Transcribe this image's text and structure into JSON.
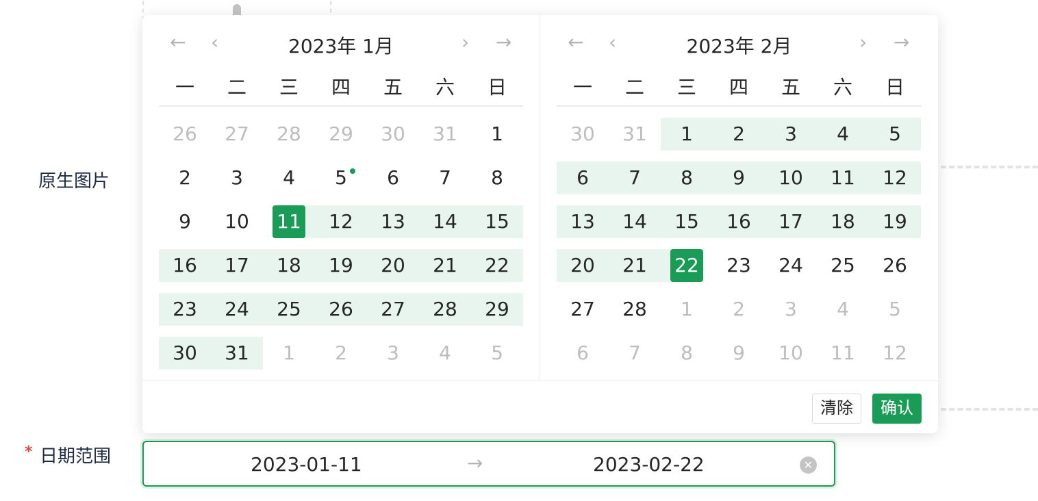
{
  "form": {
    "image_label": "原生图片",
    "range_label": "日期范围",
    "required_mark": "*"
  },
  "range": {
    "start": "2023-01-11",
    "end": "2023-02-22",
    "separator_icon": "arrow-right-icon",
    "clear_icon": "close-circle-icon"
  },
  "calendar": {
    "nav_icons": {
      "prev_year": "←",
      "prev_month": "‹",
      "next_month": "›",
      "next_year": "→"
    },
    "weekdays": [
      "一",
      "二",
      "三",
      "四",
      "五",
      "六",
      "日"
    ],
    "left": {
      "title": "2023年 1月",
      "days": [
        "26",
        "27",
        "28",
        "29",
        "30",
        "31",
        "1",
        "2",
        "3",
        "4",
        "5",
        "6",
        "7",
        "8",
        "9",
        "10",
        "11",
        "12",
        "13",
        "14",
        "15",
        "16",
        "17",
        "18",
        "19",
        "20",
        "21",
        "22",
        "23",
        "24",
        "25",
        "26",
        "27",
        "28",
        "29",
        "30",
        "31",
        "1",
        "2",
        "3",
        "4",
        "5"
      ],
      "first_in_month_index": 6,
      "last_in_month_index": 36,
      "range_start_index": 16,
      "range_end_index": 36,
      "today_index": 10
    },
    "right": {
      "title": "2023年 2月",
      "days": [
        "30",
        "31",
        "1",
        "2",
        "3",
        "4",
        "5",
        "6",
        "7",
        "8",
        "9",
        "10",
        "11",
        "12",
        "13",
        "14",
        "15",
        "16",
        "17",
        "18",
        "19",
        "20",
        "21",
        "22",
        "23",
        "24",
        "25",
        "26",
        "27",
        "28",
        "1",
        "2",
        "3",
        "4",
        "5",
        "6",
        "7",
        "8",
        "9",
        "10",
        "11",
        "12"
      ],
      "first_in_month_index": 2,
      "last_in_month_index": 29,
      "range_start_index": 2,
      "range_end_index": 23,
      "today_index": -1
    }
  },
  "footer": {
    "clear_label": "清除",
    "confirm_label": "确认"
  },
  "colors": {
    "accent": "#1a9c56",
    "range_bg": "#e8f5ee",
    "muted": "#bdbdbd"
  }
}
